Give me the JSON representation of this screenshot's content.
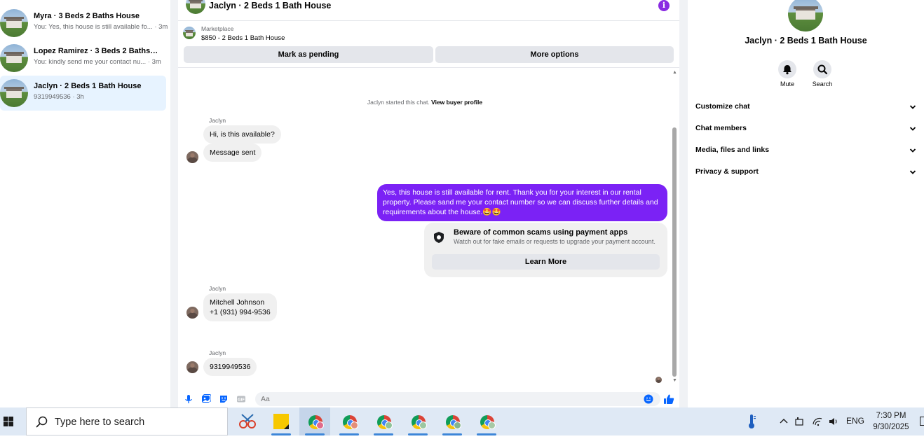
{
  "sidebar": {
    "conversations": [
      {
        "title": "Myra · 3 Beds 2 Baths House",
        "preview": "You: Yes, this house is still available fo... · 3m",
        "active": false
      },
      {
        "title": "Lopez Ramirez · 3 Beds 2 Baths Ho...",
        "preview": "You: kindly send me your contact nu... · 3m",
        "active": false
      },
      {
        "title": "Jaclyn · 2 Beds 1 Bath House",
        "preview": "9319949536 · 3h",
        "active": true
      }
    ]
  },
  "chat": {
    "header_title": "Jaclyn · 2 Beds 1 Bath House",
    "info_icon": "i",
    "marketplace": {
      "label": "Marketplace",
      "listing": "$850 - 2 Beds 1 Bath House",
      "mark_pending_label": "Mark as pending",
      "more_options_label": "More options"
    },
    "system_message": {
      "text": "Jaclyn started this chat.",
      "link": "View buyer profile"
    },
    "messages": {
      "m1_sender": "Jaclyn",
      "m1_text": "Hi, is this available?",
      "m2_text": "Message sent",
      "outgoing_text": "Yes, this house is still available for rent. Thank you for your interest in our rental property. Please sand me your contact number so we can discuss further details and requirements about the house.🤩🤩",
      "m3_sender": "Jaclyn",
      "m3_line1": "Mitchell Johnson",
      "m3_line2": "+1 (931) 994-9536",
      "m4_sender": "Jaclyn",
      "m4_text": "9319949536"
    },
    "scam_notice": {
      "title": "Beware of common scams using payment apps",
      "subtitle": "Watch out for fake emails or requests to upgrade your payment account.",
      "button_label": "Learn More"
    },
    "composer": {
      "placeholder": "Aa"
    }
  },
  "info_panel": {
    "name": "Jaclyn · 2 Beds 1 Bath House",
    "mute_label": "Mute",
    "search_label": "Search",
    "sections": [
      "Customize chat",
      "Chat members",
      "Media, files and links",
      "Privacy & support"
    ]
  },
  "taskbar": {
    "search_placeholder": "Type here to search",
    "language": "ENG",
    "time": "7:30 PM",
    "date": "9/30/2025"
  },
  "colors": {
    "outgoing_bubble": "#7b22f5",
    "active_conversation": "#e7f3ff",
    "like_blue": "#0866ff"
  }
}
